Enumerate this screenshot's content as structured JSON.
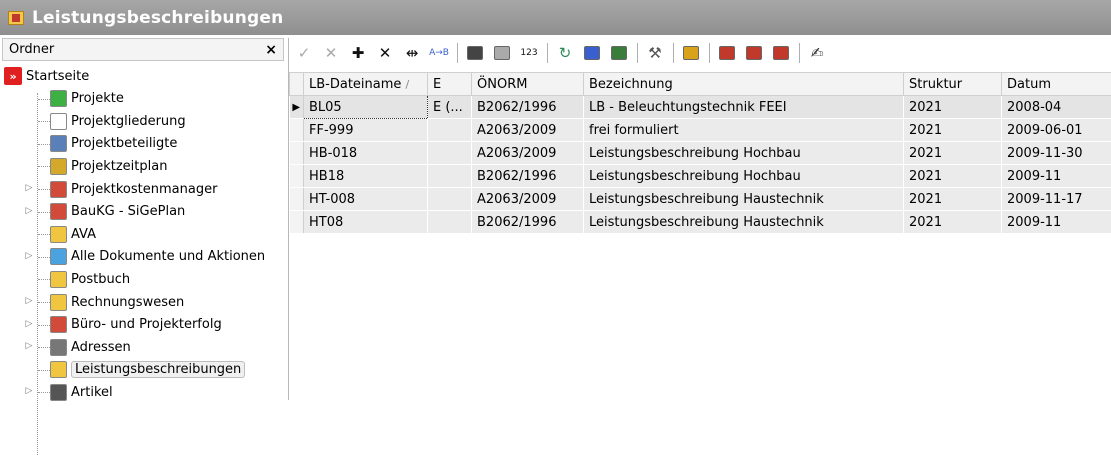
{
  "window": {
    "title": "Leistungsbeschreibungen"
  },
  "sidebar": {
    "header": "Ordner",
    "close": "×",
    "items": [
      {
        "label": "Startseite",
        "icon": "start-icon",
        "color": "#e02020"
      },
      {
        "label": "Projekte",
        "icon": "projects-icon",
        "color": "#3cb043"
      },
      {
        "label": "Projektgliederung",
        "icon": "outline-icon",
        "color": "#ffffff"
      },
      {
        "label": "Projektbeteiligte",
        "icon": "people-icon",
        "color": "#5b7fb8"
      },
      {
        "label": "Projektzeitplan",
        "icon": "schedule-icon",
        "color": "#d4a82a"
      },
      {
        "label": "Projektkostenmanager",
        "icon": "cost-chart-icon",
        "color": "#d24a3a"
      },
      {
        "label": "BauKG - SiGePlan",
        "icon": "safety-icon",
        "color": "#d24a3a"
      },
      {
        "label": "AVA",
        "icon": "ava-icon",
        "color": "#f0c640"
      },
      {
        "label": "Alle Dokumente und Aktionen",
        "icon": "documents-icon",
        "color": "#4aa3df"
      },
      {
        "label": "Postbuch",
        "icon": "mail-icon",
        "color": "#f0c640"
      },
      {
        "label": "Rechnungswesen",
        "icon": "accounting-icon",
        "color": "#f0c640"
      },
      {
        "label": "Büro- und Projekterfolg",
        "icon": "success-chart-icon",
        "color": "#d24a3a"
      },
      {
        "label": "Adressen",
        "icon": "address-icon",
        "color": "#777777"
      },
      {
        "label": "Leistungsbeschreibungen",
        "icon": "specification-icon",
        "color": "#f0c640"
      },
      {
        "label": "Artikel",
        "icon": "article-icon",
        "color": "#555555"
      }
    ]
  },
  "toolbar": {
    "buttons": [
      {
        "icon": "check-icon",
        "glyph": "✓"
      },
      {
        "icon": "cancel-icon",
        "glyph": "✕"
      },
      {
        "icon": "add-icon",
        "glyph": "✚"
      },
      {
        "icon": "delete-icon",
        "glyph": "✕"
      },
      {
        "icon": "column-width-icon",
        "glyph": "⇹"
      },
      {
        "icon": "sort-ab-icon",
        "glyph": "A→B"
      },
      {
        "icon": "binoculars-icon",
        "glyph": ""
      },
      {
        "icon": "binoculars-disabled-icon",
        "glyph": ""
      },
      {
        "icon": "numbering-icon",
        "glyph": "123"
      },
      {
        "icon": "refresh-icon",
        "glyph": "↻"
      },
      {
        "icon": "copy-icon",
        "glyph": ""
      },
      {
        "icon": "structure-icon",
        "glyph": ""
      },
      {
        "icon": "tools-icon",
        "glyph": "⚒"
      },
      {
        "icon": "open-folder-icon",
        "glyph": ""
      },
      {
        "icon": "export-icon",
        "glyph": ""
      },
      {
        "icon": "export-multi-icon",
        "glyph": ""
      },
      {
        "icon": "import-icon",
        "glyph": ""
      },
      {
        "icon": "sign-icon",
        "glyph": "✍"
      }
    ]
  },
  "grid": {
    "columns": [
      "LB-Dateiname",
      "E",
      "ÖNORM",
      "Bezeichnung",
      "Struktur",
      "Datum"
    ],
    "sort_indicator": "/",
    "rows": [
      {
        "file": "BL05",
        "e": "E (...",
        "norm": "B2062/1996",
        "desc": "LB - Beleuchtungstechnik FEEI",
        "struktur": "2021",
        "datum": "2008-04"
      },
      {
        "file": "FF-999",
        "e": "",
        "norm": "A2063/2009",
        "desc": "frei formuliert",
        "struktur": "2021",
        "datum": "2009-06-01"
      },
      {
        "file": "HB-018",
        "e": "",
        "norm": "A2063/2009",
        "desc": "Leistungsbeschreibung Hochbau",
        "struktur": "2021",
        "datum": "2009-11-30"
      },
      {
        "file": "HB18",
        "e": "",
        "norm": "B2062/1996",
        "desc": "Leistungsbeschreibung Hochbau",
        "struktur": "2021",
        "datum": "2009-11"
      },
      {
        "file": "HT-008",
        "e": "",
        "norm": "A2063/2009",
        "desc": "Leistungsbeschreibung Haustechnik",
        "struktur": "2021",
        "datum": "2009-11-17"
      },
      {
        "file": "HT08",
        "e": "",
        "norm": "B2062/1996",
        "desc": "Leistungsbeschreibung Haustechnik",
        "struktur": "2021",
        "datum": "2009-11"
      }
    ],
    "current_row": 0
  }
}
